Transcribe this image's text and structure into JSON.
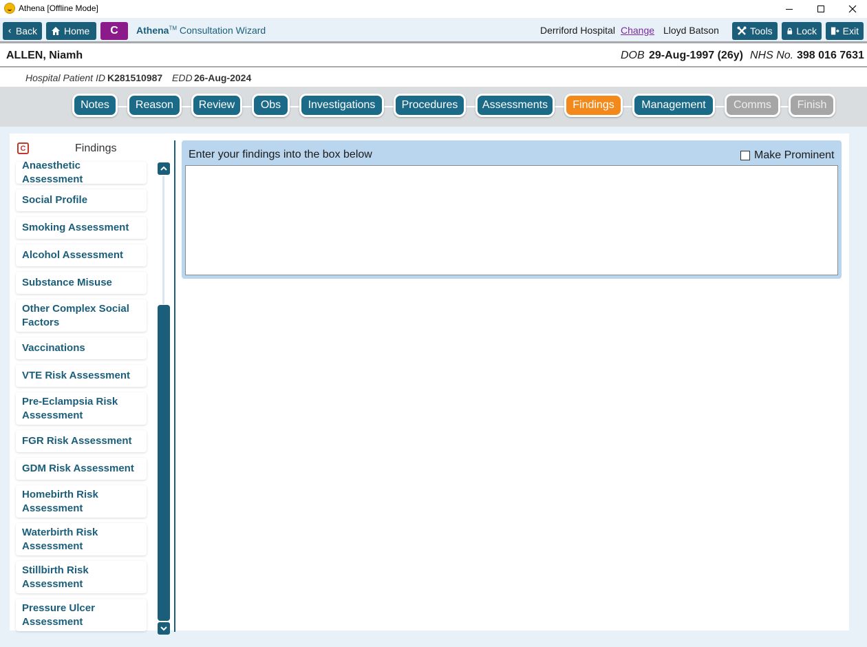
{
  "window": {
    "title": "Athena [Offline Mode]"
  },
  "toolbar": {
    "back_label": "Back",
    "home_label": "Home",
    "c_label": "C",
    "app_brand": "Athena",
    "app_tm": "TM",
    "app_subtitle": "Consultation Wizard",
    "hospital": "Derriford Hospital",
    "change_label": "Change",
    "user": "Lloyd Batson",
    "tools_label": "Tools",
    "lock_label": "Lock",
    "exit_label": "Exit"
  },
  "patient": {
    "name": "ALLEN, Niamh",
    "dob_label": "DOB",
    "dob_value": "29-Aug-1997 (26y)",
    "nhs_label": "NHS No.",
    "nhs_value": "398 016 7631",
    "hospital_id_label": "Hospital Patient ID",
    "hospital_id_value": "K281510987",
    "edd_label": "EDD",
    "edd_value": "26-Aug-2024"
  },
  "steps": [
    {
      "label": "Notes",
      "state": "normal"
    },
    {
      "label": "Reason",
      "state": "normal"
    },
    {
      "label": "Review",
      "state": "normal"
    },
    {
      "label": "Obs",
      "state": "normal"
    },
    {
      "label": "Investigations",
      "state": "normal"
    },
    {
      "label": "Procedures",
      "state": "normal"
    },
    {
      "label": "Assessments",
      "state": "normal"
    },
    {
      "label": "Findings",
      "state": "active"
    },
    {
      "label": "Management",
      "state": "normal"
    },
    {
      "label": "Comms",
      "state": "disabled"
    },
    {
      "label": "Finish",
      "state": "disabled"
    }
  ],
  "sidebar": {
    "title": "Findings",
    "items": [
      "Anaesthetic Assessment",
      "Social Profile",
      "Smoking Assessment",
      "Alcohol Assessment",
      "Substance Misuse",
      "Other Complex Social Factors",
      "Vaccinations",
      "VTE Risk Assessment",
      "Pre-Eclampsia Risk Assessment",
      "FGR Risk Assessment",
      "GDM Risk Assessment",
      "Homebirth Risk Assessment",
      "Waterbirth Risk Assessment",
      "Stillbirth Risk Assessment",
      "Pressure Ulcer Assessment"
    ]
  },
  "findings": {
    "prompt": "Enter your findings into the box below",
    "make_prominent_label": "Make Prominent",
    "make_prominent_checked": false,
    "text_value": ""
  },
  "colors": {
    "primary": "#1b5e7a",
    "active_step": "#f2891a",
    "disabled_step": "#a6a6a6",
    "c_button": "#8b1b8a",
    "link": "#7a2aa0",
    "findings_header": "#b9d6ee"
  }
}
